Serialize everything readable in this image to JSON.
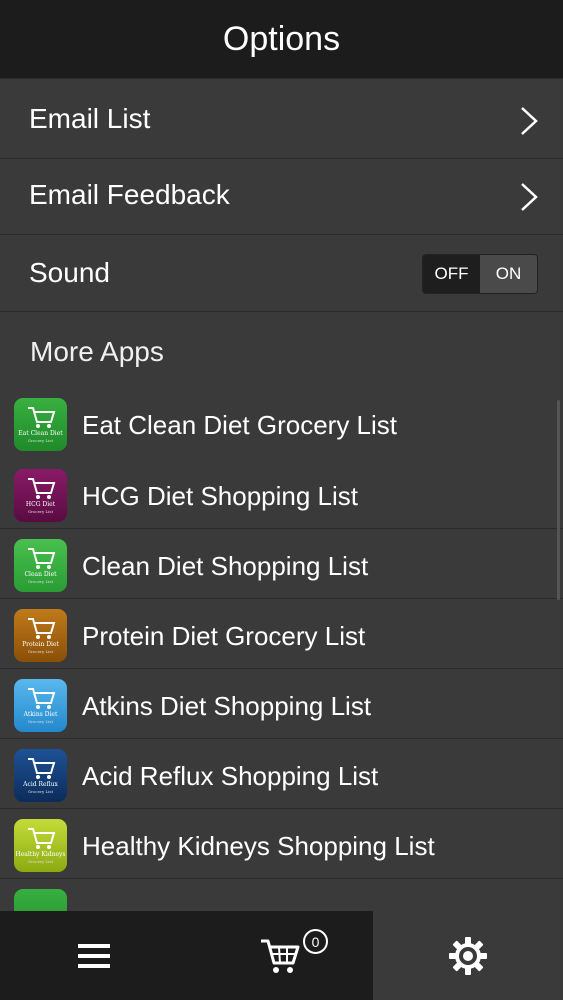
{
  "header": {
    "title": "Options"
  },
  "options": {
    "email_list": "Email List",
    "email_feedback": "Email Feedback",
    "sound": "Sound",
    "sound_off": "OFF",
    "sound_on": "ON"
  },
  "more_apps": {
    "label": "More Apps",
    "items": [
      {
        "name": "Eat Clean Diet Grocery List",
        "icon_caption": "Eat Clean Diet",
        "icon_sub": "Grocery List",
        "color": "#1f8a2a"
      },
      {
        "name": "HCG Diet Shopping List",
        "icon_caption": "HCG Diet",
        "icon_sub": "Grocery List",
        "color": "#6a0d4e"
      },
      {
        "name": "Clean Diet Shopping List",
        "icon_caption": "Clean Diet",
        "icon_sub": "Grocery List",
        "color": "#2a9c34"
      },
      {
        "name": "Protein Diet Grocery List",
        "icon_caption": "Protein Diet",
        "icon_sub": "Grocery List",
        "color": "#9a5a0c"
      },
      {
        "name": "Atkins Diet Shopping List",
        "icon_caption": "Atkins Diet",
        "icon_sub": "Grocery List",
        "color": "#2e9ad8"
      },
      {
        "name": "Acid Reflux Shopping List",
        "icon_caption": "Acid Reflux",
        "icon_sub": "Grocery List",
        "color": "#123c74"
      },
      {
        "name": "Healthy Kidneys Shopping List",
        "icon_caption": "Healthy Kidneys",
        "icon_sub": "Grocery List",
        "color": "#a6c21e"
      },
      {
        "name": "",
        "icon_caption": "",
        "icon_sub": "",
        "color": "#1f8a2a"
      }
    ]
  },
  "tabbar": {
    "menu_icon": "hamburger-menu-icon",
    "cart_icon": "shopping-cart-icon",
    "cart_count": "0",
    "settings_icon": "gear-icon"
  }
}
